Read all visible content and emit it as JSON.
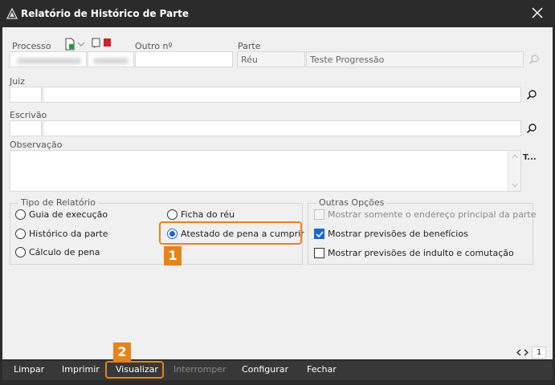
{
  "window": {
    "title": "Relatório de Histórico de Parte"
  },
  "labels": {
    "processo": "Processo",
    "outro": "Outro nº",
    "parte": "Parte",
    "juiz": "Juiz",
    "escrivao": "Escrivão",
    "observacao": "Observação"
  },
  "parte": {
    "tipo": "Réu",
    "nome": "Teste Progressão"
  },
  "obs_side_label": "T...",
  "tipo_relatorio": {
    "title": "Tipo de Relatório",
    "options": [
      {
        "label": "Guia de execução",
        "selected": false
      },
      {
        "label": "Histórico da parte",
        "selected": false
      },
      {
        "label": "Cálculo de pena",
        "selected": false
      },
      {
        "label": "Ficha do réu",
        "selected": false
      },
      {
        "label": "Atestado de pena a cumprir",
        "selected": true
      }
    ]
  },
  "outras_opcoes": {
    "title": "Outras Opções",
    "options": [
      {
        "label": "Mostrar somente o endereço principal da parte",
        "checked": false,
        "enabled": false
      },
      {
        "label": "Mostrar previsões de benefícios",
        "checked": true,
        "enabled": true
      },
      {
        "label": "Mostrar previsões de indulto e comutação",
        "checked": false,
        "enabled": true
      }
    ]
  },
  "steps": [
    "1",
    "2"
  ],
  "pager": {
    "page": "1"
  },
  "toolbar": {
    "limpar": "Limpar",
    "imprimir": "Imprimir",
    "visualizar": "Visualizar",
    "interromper": "Interromper",
    "configurar": "Configurar",
    "fechar": "Fechar"
  },
  "colors": {
    "accent": "#1a66d6",
    "highlight": "#e8831a",
    "chrome": "#2b2b2b"
  }
}
